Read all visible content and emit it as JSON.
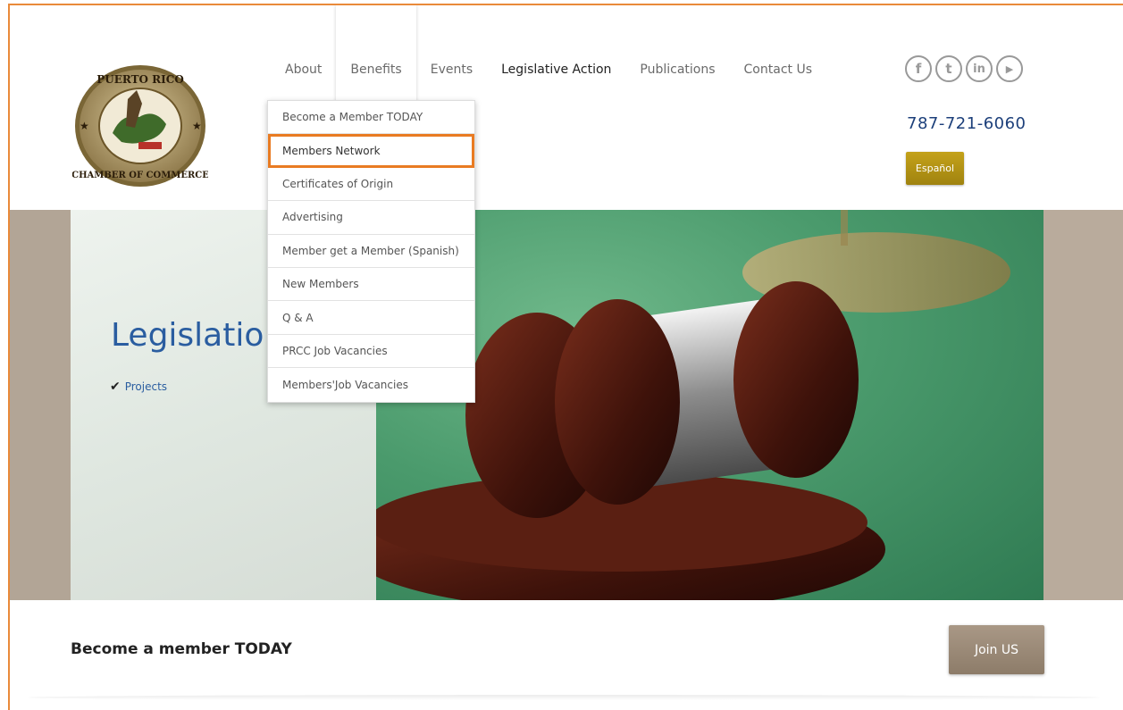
{
  "logo": {
    "text_top": "PUERTO RICO",
    "text_bottom": "CHAMBER OF COMMERCE"
  },
  "nav": {
    "items": [
      {
        "label": "About"
      },
      {
        "label": "Benefits"
      },
      {
        "label": "Events"
      },
      {
        "label": "Legislative Action"
      },
      {
        "label": "Publications"
      },
      {
        "label": "Contact Us"
      }
    ]
  },
  "dropdown": {
    "items": [
      {
        "label": "Become a Member TODAY"
      },
      {
        "label": "Members Network"
      },
      {
        "label": "Certificates of Origin"
      },
      {
        "label": "Advertising"
      },
      {
        "label": "Member get a Member (Spanish)"
      },
      {
        "label": "New Members"
      },
      {
        "label": "Q & A"
      },
      {
        "label": "PRCC Job Vacancies"
      },
      {
        "label": "Members'Job Vacancies"
      }
    ]
  },
  "header": {
    "phone": "787-721-6060",
    "language_button": "Español",
    "social": [
      {
        "icon": "facebook-icon",
        "glyph": "f"
      },
      {
        "icon": "twitter-icon",
        "glyph": "t"
      },
      {
        "icon": "linkedin-icon",
        "glyph": "in"
      },
      {
        "icon": "youtube-icon",
        "glyph": "▶"
      }
    ]
  },
  "banner": {
    "title": "Legislatio",
    "link": "Projects"
  },
  "cta": {
    "title": "Become a member TODAY",
    "button": "Join US"
  },
  "colors": {
    "accent_orange": "#e97b22",
    "link_blue": "#2a5da0",
    "phone_blue": "#1c3f7a",
    "gold_button": "#b3941a",
    "join_button": "#9a8976"
  }
}
